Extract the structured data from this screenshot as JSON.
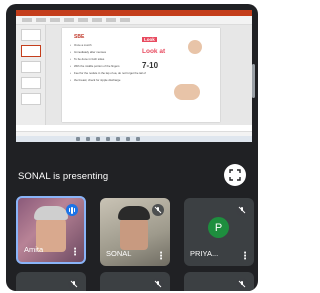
{
  "presentation": {
    "heading": "SBE",
    "tag": "Look",
    "big_text": "Look at",
    "mid_text": "7-10",
    "bullets": [
      "Once a month",
      "Immediately after menses",
      "To be done in both sides",
      "With the middle portion of the fingers",
      "Feel for the nodule in the lap of ea, do not forget the tail of",
      "the breast; check for nipple discharge"
    ]
  },
  "presenter": {
    "text": "SONAL is presenting"
  },
  "participants": [
    {
      "name": "Amita"
    },
    {
      "name": "SONAL"
    },
    {
      "name": "PRIYA...",
      "initial": "P"
    }
  ],
  "colors": {
    "background": "#202124",
    "tile_blue": "#1a73e8",
    "avatar_green": "#1e8e3e",
    "ppt_red": "#c43e1c"
  },
  "icons": [
    "fullscreen-icon",
    "mic-off-icon",
    "speaking-icon",
    "more-vert-icon"
  ]
}
